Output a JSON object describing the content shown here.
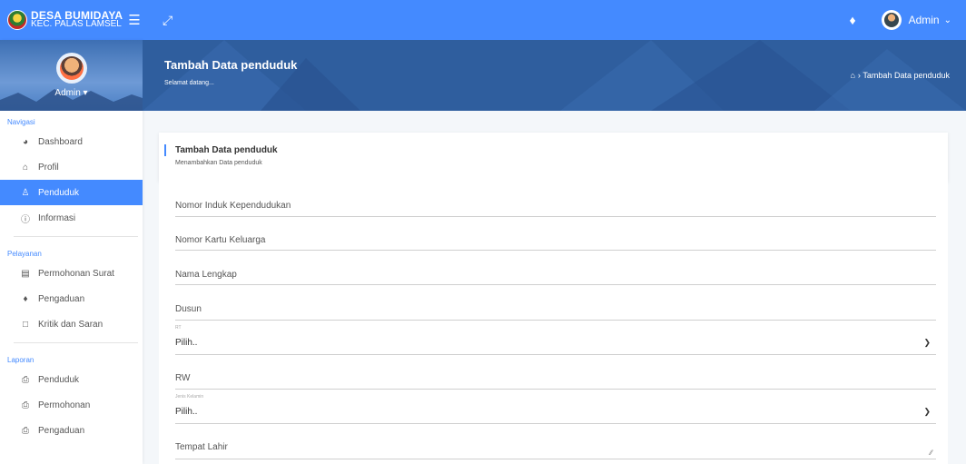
{
  "brand": {
    "title": "DESA BUMIDAYA",
    "subtitle": "KEC. PALAS LAMSEL"
  },
  "topbar": {
    "user": "Admin",
    "menu_icon": "hamburger-icon",
    "expand_icon": "fullscreen-icon",
    "bell_icon": "bell-icon"
  },
  "sidebar": {
    "profile_name": "Admin",
    "groups": [
      {
        "label": "Navigasi",
        "items": [
          {
            "label": "Dashboard",
            "icon": "dashboard-icon"
          },
          {
            "label": "Profil",
            "icon": "home-icon"
          },
          {
            "label": "Penduduk",
            "icon": "user-icon",
            "active": true
          },
          {
            "label": "Informasi",
            "icon": "info-icon"
          }
        ]
      },
      {
        "label": "Pelayanan",
        "items": [
          {
            "label": "Permohonan Surat",
            "icon": "document-icon"
          },
          {
            "label": "Pengaduan",
            "icon": "bell-icon"
          },
          {
            "label": "Kritik dan Saran",
            "icon": "message-icon"
          }
        ]
      },
      {
        "label": "Laporan",
        "items": [
          {
            "label": "Penduduk",
            "icon": "printer-icon"
          },
          {
            "label": "Permohonan",
            "icon": "printer-icon"
          },
          {
            "label": "Pengaduan",
            "icon": "printer-icon"
          }
        ]
      }
    ]
  },
  "header": {
    "title": "Tambah Data penduduk",
    "subtitle": "Selamat datang...",
    "breadcrumb": "Tambah Data penduduk"
  },
  "card": {
    "title": "Tambah Data penduduk",
    "subtitle": "Menambahkan Data penduduk"
  },
  "form": {
    "nik": "Nomor Induk Kependudukan",
    "kk": "Nomor Kartu Keluarga",
    "nama": "Nama Lengkap",
    "dusun": "Dusun",
    "rt_label": "RT",
    "rt_value": "Pilih..",
    "rw": "RW",
    "jk_label": "Jenis Kelamin",
    "jk_value": "Pilih..",
    "tempat_lahir": "Tempat Lahir"
  },
  "colors": {
    "primary": "#448aff",
    "banner": "#2f5e9e"
  }
}
